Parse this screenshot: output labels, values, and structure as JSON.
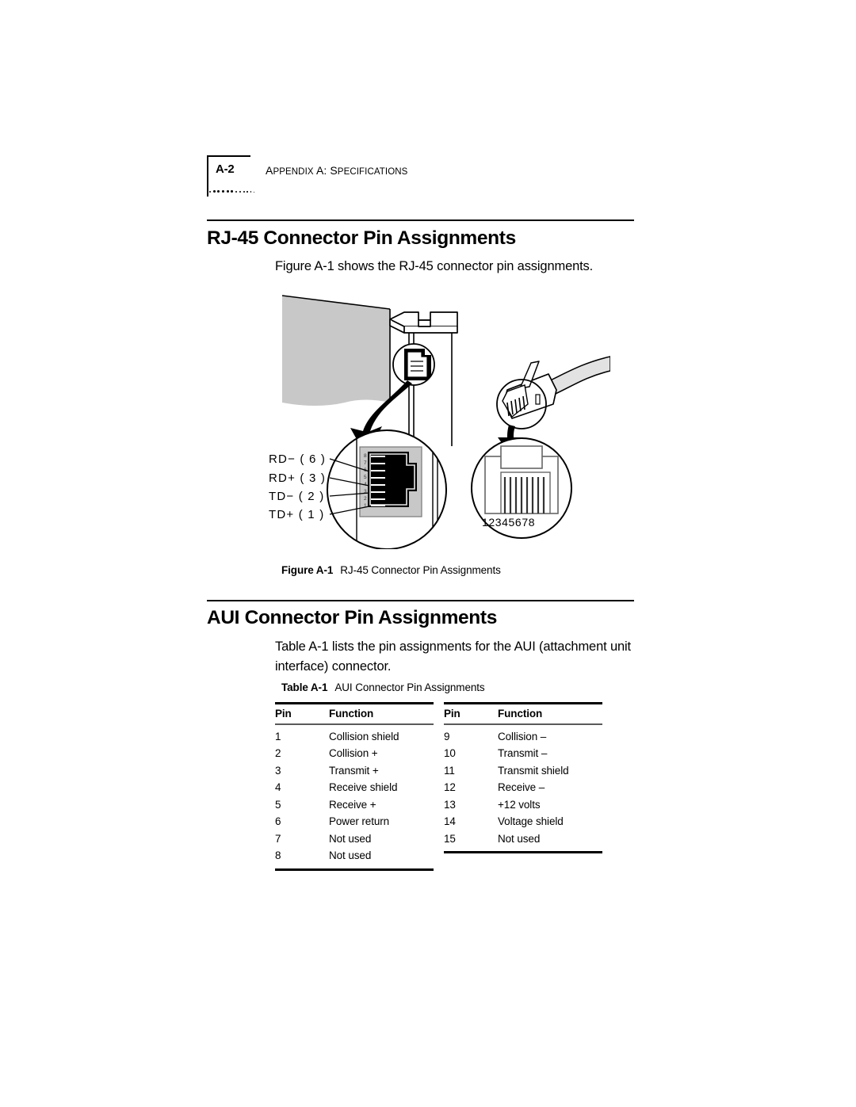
{
  "running_head": {
    "page_number": "A-2",
    "chapter_prefix": "A",
    "chapter_text_a": "PPENDIX ",
    "chapter_text_b": "A: S",
    "chapter_text_c": "PECIFICATIONS"
  },
  "sections": [
    {
      "heading": "RJ-45 Connector Pin Assignments",
      "body": "Figure A-1 shows the RJ-45 connector pin assignments."
    },
    {
      "heading": "AUI Connector Pin Assignments",
      "body": "Table A-1 lists the pin assignments for the AUI (attachment unit interface) connector."
    }
  ],
  "figure": {
    "caption_label": "Figure A-1",
    "caption_text": "RJ-45 Connector Pin Assignments",
    "jack_labels": [
      "RD− ( 6 )",
      "RD+ ( 3 )",
      "TD− ( 2 )",
      "TD+ ( 1 )"
    ],
    "jack_pin_numbers": [
      "8",
      "7",
      "6",
      "5",
      "4",
      "3",
      "2",
      "1"
    ],
    "plug_pin_numbers": "12345678"
  },
  "table": {
    "caption_label": "Table A-1",
    "caption_text": "AUI Connector Pin Assignments",
    "columns": [
      "Pin",
      "Function"
    ],
    "left_rows": [
      [
        "1",
        "Collision shield"
      ],
      [
        "2",
        "Collision +"
      ],
      [
        "3",
        "Transmit +"
      ],
      [
        "4",
        "Receive shield"
      ],
      [
        "5",
        "Receive +"
      ],
      [
        "6",
        "Power return"
      ],
      [
        "7",
        "Not used"
      ],
      [
        "8",
        "Not used"
      ]
    ],
    "right_rows": [
      [
        "9",
        "Collision –"
      ],
      [
        "10",
        "Transmit –"
      ],
      [
        "11",
        "Transmit shield"
      ],
      [
        "12",
        "Receive –"
      ],
      [
        "13",
        "+12 volts"
      ],
      [
        "14",
        "Voltage shield"
      ],
      [
        "15",
        "Not used"
      ]
    ]
  },
  "colors": {
    "ink": "#000000",
    "card_gray": "#c8c8c8",
    "panel_gray": "#b4b4b4",
    "rule_gray": "#5a5a5a"
  }
}
